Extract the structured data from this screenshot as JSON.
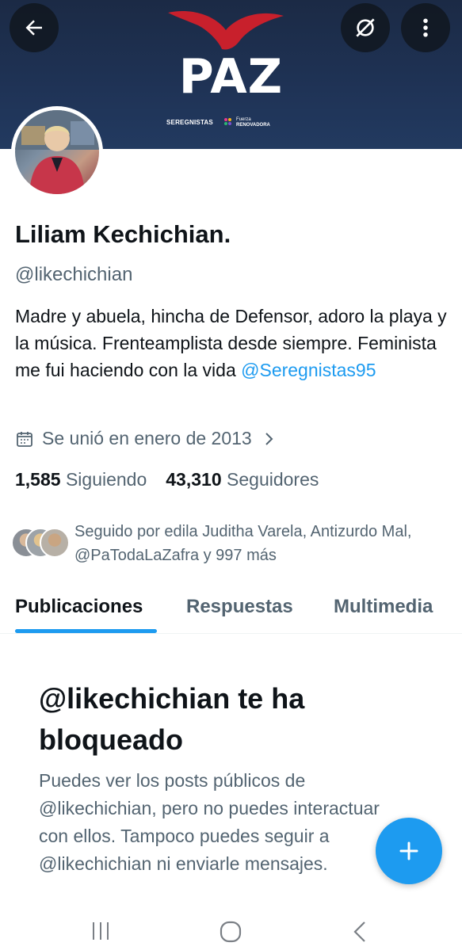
{
  "banner": {
    "title": "PAZ",
    "party_left": "SEREGNISTAS",
    "party_right_line1": "Fuerza",
    "party_right_line2": "RENOVADORA"
  },
  "header": {
    "back_icon": "arrow-left-icon",
    "spaces_icon": "spaces-slash-icon",
    "more_icon": "more-vertical-icon"
  },
  "profile": {
    "name": "Liliam Kechichian.",
    "handle": "@likechichian",
    "bio_text": "Madre y abuela, hincha de Defensor, adoro la playa y la música. Frenteamplista desde siempre. Feminista me fui haciendo con la vida ",
    "bio_link": "@Seregnistas95",
    "joined": "Se unió en enero de 2013",
    "following_count": "1,585",
    "following_label": "Siguiendo",
    "followers_count": "43,310",
    "followers_label": "Seguidores",
    "followed_by": "Seguido por edila Juditha Varela, Antizurdo Mal, @PaTodaLaZafra y 997 más"
  },
  "tabs": [
    {
      "label": "Publicaciones",
      "active": true
    },
    {
      "label": "Respuestas",
      "active": false
    },
    {
      "label": "Multimedia",
      "active": false
    }
  ],
  "blocked": {
    "title": "@likechichian te ha bloqueado",
    "text": "Puedes ver los posts públicos de @likechichian, pero no puedes interactuar con ellos. Tampoco puedes seguir a @likechichian ni enviarle mensajes."
  },
  "fab": {
    "icon": "plus-icon"
  },
  "colors": {
    "accent": "#1d9bf0",
    "banner": "#1f3356",
    "brand_red": "#c8202c"
  }
}
